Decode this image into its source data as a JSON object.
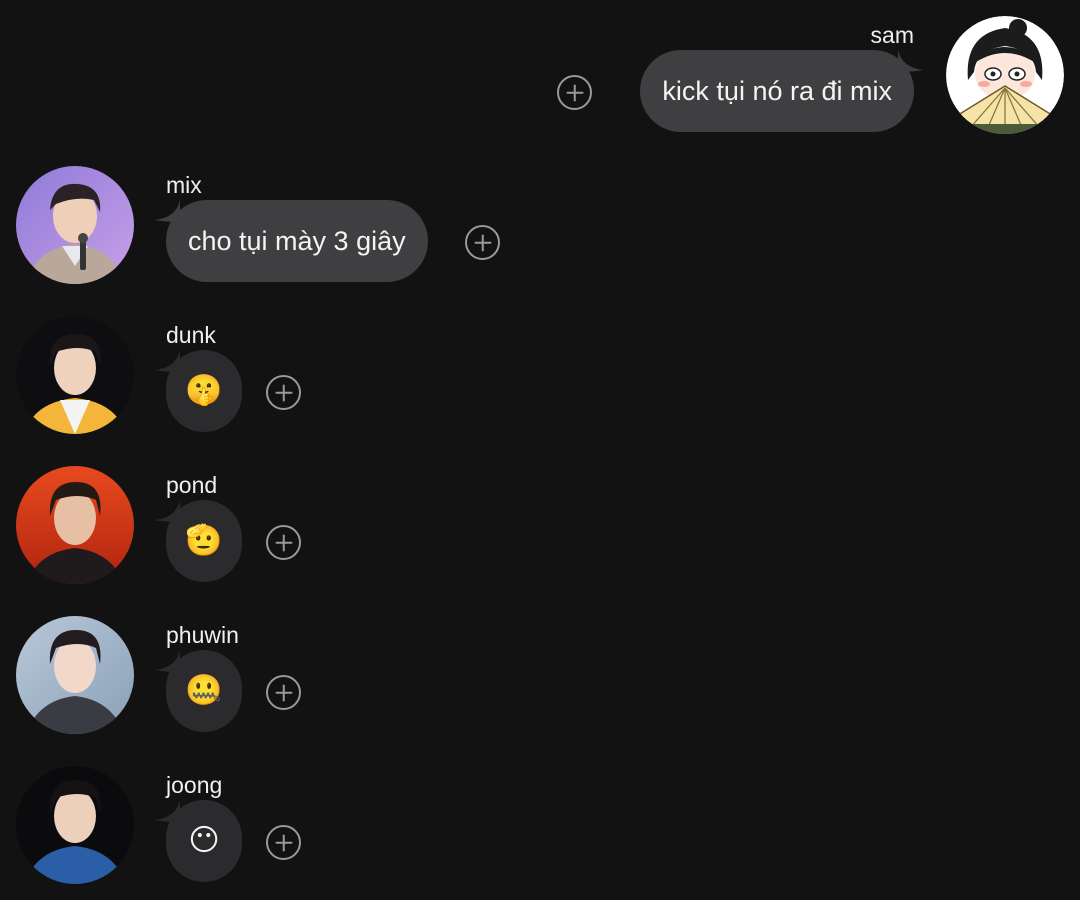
{
  "messages": [
    {
      "sender": "sam",
      "text": "kick tụi nó ra đi mix",
      "side": "right",
      "avatar": "cartoon-girl-with-fan-avatar"
    },
    {
      "sender": "mix",
      "text": "cho tụi mày 3 giây",
      "side": "left",
      "avatar": "mix-avatar"
    },
    {
      "sender": "dunk",
      "text": "🤫",
      "side": "left",
      "avatar": "dunk-avatar"
    },
    {
      "sender": "pond",
      "text": "🫡",
      "side": "left",
      "avatar": "pond-avatar"
    },
    {
      "sender": "phuwin",
      "text": "🤐",
      "side": "left",
      "avatar": "phuwin-avatar"
    },
    {
      "sender": "joong",
      "text": "😶",
      "side": "left",
      "avatar": "joong-avatar"
    }
  ],
  "icons": {
    "reaction": "add-reaction-icon"
  },
  "colors": {
    "background": "#121213",
    "bubble": "#3f3f41",
    "emoji_bubble": "#2b2b2d",
    "icon": "#9a9a9c"
  }
}
